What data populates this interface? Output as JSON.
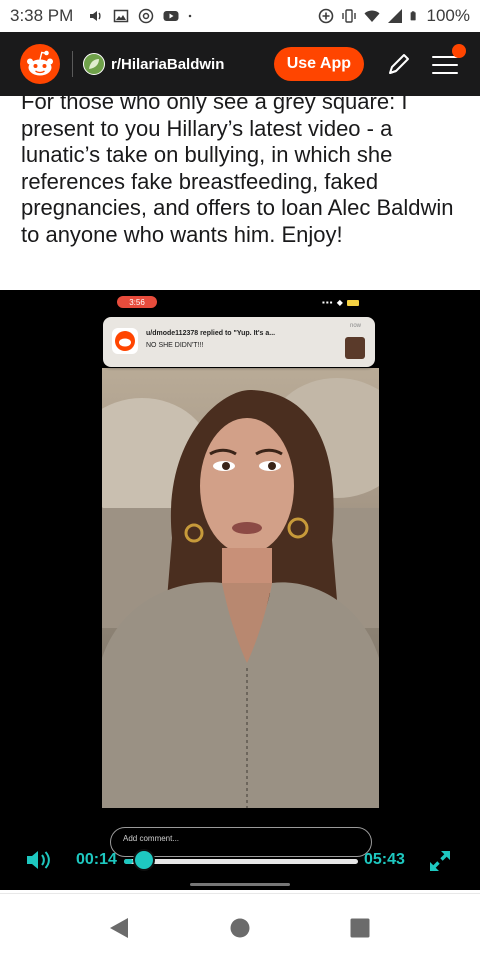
{
  "status_bar": {
    "time": "3:38 PM",
    "battery": "100%"
  },
  "header": {
    "subreddit": "r/HilariaBaldwin",
    "use_app_label": "Use App",
    "brand_color": "#ff4500"
  },
  "post": {
    "text": "For those who only see a grey square: I present to you Hillary’s latest video - a lunatic’s take on bullying, in which she references fake breastfeeding, faked pregnancies, and offers to loan Alec Baldwin to anyone who wants him. Enjoy!"
  },
  "video": {
    "frame_time": "3:56",
    "notification": {
      "title": "u/dmode112378 replied to \"Yup. It's a...",
      "body": "NO SHE DIDN'T!!!",
      "time": "now"
    },
    "comment_placeholder": "Add comment...",
    "current_time": "00:14",
    "total_time": "05:43",
    "progress": 0.04,
    "accent_color": "#1ec8c0"
  },
  "icons": {
    "volume": "volume-icon",
    "expand": "expand-icon",
    "pencil": "pencil-icon",
    "menu": "menu-icon",
    "back": "back-icon",
    "home": "home-icon",
    "recents": "recents-icon"
  }
}
